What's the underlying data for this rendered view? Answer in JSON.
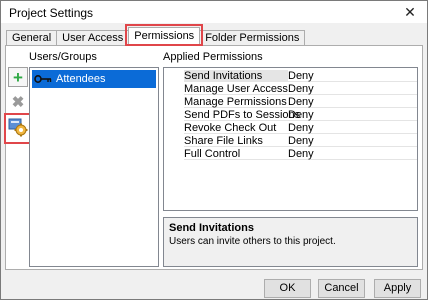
{
  "window": {
    "title": "Project Settings",
    "close_glyph": "✕"
  },
  "tabs": [
    {
      "label": "General"
    },
    {
      "label": "User Access"
    },
    {
      "label": "Permissions",
      "active": true
    },
    {
      "label": "Folder Permissions"
    }
  ],
  "users": {
    "title": "Users/Groups",
    "toolbar": {
      "add_icon": "plus-icon",
      "delete_icon": "x-icon",
      "configure_icon": "settings-gear-icon"
    },
    "items": [
      {
        "label": "Attendees",
        "icon": "key-icon",
        "selected": true
      }
    ]
  },
  "permissions": {
    "title": "Applied Permissions",
    "rows": [
      {
        "name": "Send Invitations",
        "value": "Deny",
        "selected": true
      },
      {
        "name": "Manage User Access",
        "value": "Deny"
      },
      {
        "name": "Manage Permissions",
        "value": "Deny"
      },
      {
        "name": "Send PDFs to Sessions",
        "value": "Deny"
      },
      {
        "name": "Revoke Check Out",
        "value": "Deny"
      },
      {
        "name": "Share File Links",
        "value": "Deny"
      },
      {
        "name": "Full Control",
        "value": "Deny"
      }
    ]
  },
  "description": {
    "title": "Send Invitations",
    "text": "Users can invite others to this project."
  },
  "buttons": {
    "ok": "OK",
    "cancel": "Cancel",
    "apply": "Apply"
  },
  "colors": {
    "selection": "#0b6bd7",
    "highlight_outline": "#e0464a",
    "add_green": "#2fa844"
  }
}
